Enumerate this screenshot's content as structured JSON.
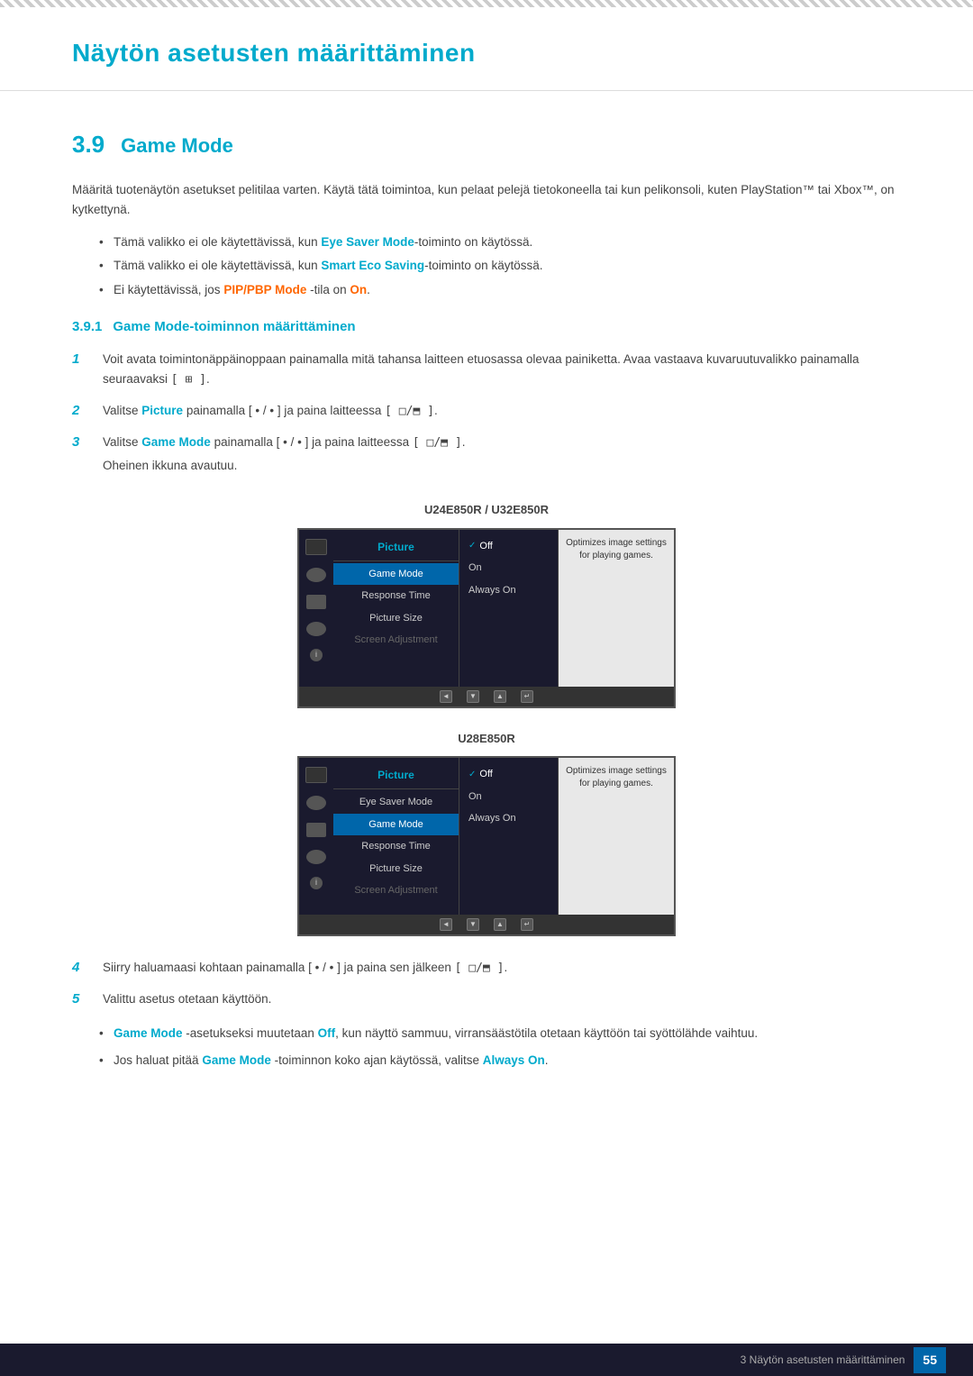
{
  "page": {
    "title": "Näytön asetusten määrittäminen",
    "footer_text": "3 Näytön asetusten määrittäminen",
    "footer_page": "55"
  },
  "section": {
    "number": "3.9",
    "title": "Game Mode",
    "body": "Määritä tuotenäytön asetukset pelitilaa varten. Käytä tätä toimintoa, kun pelaat pelejä tietokoneella tai kun pelikonsoli, kuten PlayStation™ tai Xbox™, on kytkettynä.",
    "bullets": [
      {
        "text_before": "Tämä valikko ei ole käytettävissä, kun ",
        "highlight": "Eye Saver Mode",
        "text_after": "-toiminto on käytössä.",
        "highlight_type": "blue"
      },
      {
        "text_before": "Tämä valikko ei ole käytettävissä, kun ",
        "highlight": "Smart Eco Saving",
        "text_after": "-toiminto on käytössä.",
        "highlight_type": "blue"
      },
      {
        "text_before": "Ei käytettävissä, jos ",
        "highlight": "PIP/PBP Mode",
        "text_after": " -tila on ",
        "highlight2": "On",
        "text_end": ".",
        "highlight_type": "orange",
        "highlight2_type": "orange"
      }
    ],
    "subsection": {
      "number": "3.9.1",
      "title": "Game Mode-toiminnon määrittäminen",
      "steps": [
        {
          "num": "1",
          "text": "Voit avata toimintonäppäinoppaan painamalla mitä tahansa laitteen etuosassa olevaa painiketta. Avaa vastaava kuvaruutuvalikko painamalla seuraavaksi [",
          "bracket": "⊞",
          "text_end": "]."
        },
        {
          "num": "2",
          "text_before": "Valitse ",
          "highlight": "Picture",
          "text_after": " painamalla [ • / • ] ja paina laitteessa [",
          "bracket": "□/⬒",
          "text_end": "].",
          "highlight_type": "blue"
        },
        {
          "num": "3",
          "text_before": "Valitse ",
          "highlight": "Game Mode",
          "text_after": " painamalla [ • / • ] ja paina laitteessa [",
          "bracket": "□/⬒",
          "text_end": "].",
          "highlight_type": "blue",
          "sub_text": "Oheinen ikkuna avautuu."
        }
      ],
      "screen1": {
        "label": "U24E850R / U32E850R",
        "menu_title": "Picture",
        "menu_items": [
          {
            "label": "Game Mode",
            "selected": true
          },
          {
            "label": "Response Time",
            "selected": false
          },
          {
            "label": "Picture Size",
            "selected": false
          },
          {
            "label": "Screen Adjustment",
            "selected": false,
            "dimmed": true
          }
        ],
        "submenu_items": [
          {
            "label": "Off",
            "checked": true
          },
          {
            "label": "On",
            "checked": false
          },
          {
            "label": "Always On",
            "checked": false
          }
        ],
        "tooltip": "Optimizes image settings for playing games."
      },
      "screen2": {
        "label": "U28E850R",
        "menu_title": "Picture",
        "menu_items": [
          {
            "label": "Eye Saver Mode",
            "selected": false
          },
          {
            "label": "Game Mode",
            "selected": true
          },
          {
            "label": "Response Time",
            "selected": false
          },
          {
            "label": "Picture Size",
            "selected": false
          },
          {
            "label": "Screen Adjustment",
            "selected": false,
            "dimmed": true
          }
        ],
        "submenu_items": [
          {
            "label": "Off",
            "checked": true
          },
          {
            "label": "On",
            "checked": false
          },
          {
            "label": "Always On",
            "checked": false
          }
        ],
        "tooltip": "Optimizes image settings for playing games."
      },
      "steps_after": [
        {
          "num": "4",
          "text": "Siirry haluamaasi kohtaan painamalla [ • / • ] ja paina sen jälkeen [",
          "bracket": "□/⬒",
          "text_end": "]."
        },
        {
          "num": "5",
          "text": "Valittu asetus otetaan käyttöön."
        }
      ],
      "final_bullets": [
        {
          "text_before": "",
          "highlight": "Game Mode",
          "text_middle": " -asetukseksi muutetaan ",
          "highlight2": "Off",
          "text_after": ", kun näyttö sammuu, virransäästötila otetaan käyttöön tai syöttölähde vaihtuu.",
          "highlight_type": "blue",
          "highlight2_type": "blue"
        },
        {
          "text_before": "Jos haluat pitää ",
          "highlight": "Game Mode",
          "text_middle": " -toiminnon koko ajan käytössä, valitse ",
          "highlight2": "Always On",
          "text_after": ".",
          "highlight_type": "blue",
          "highlight2_type": "blue"
        }
      ]
    }
  }
}
